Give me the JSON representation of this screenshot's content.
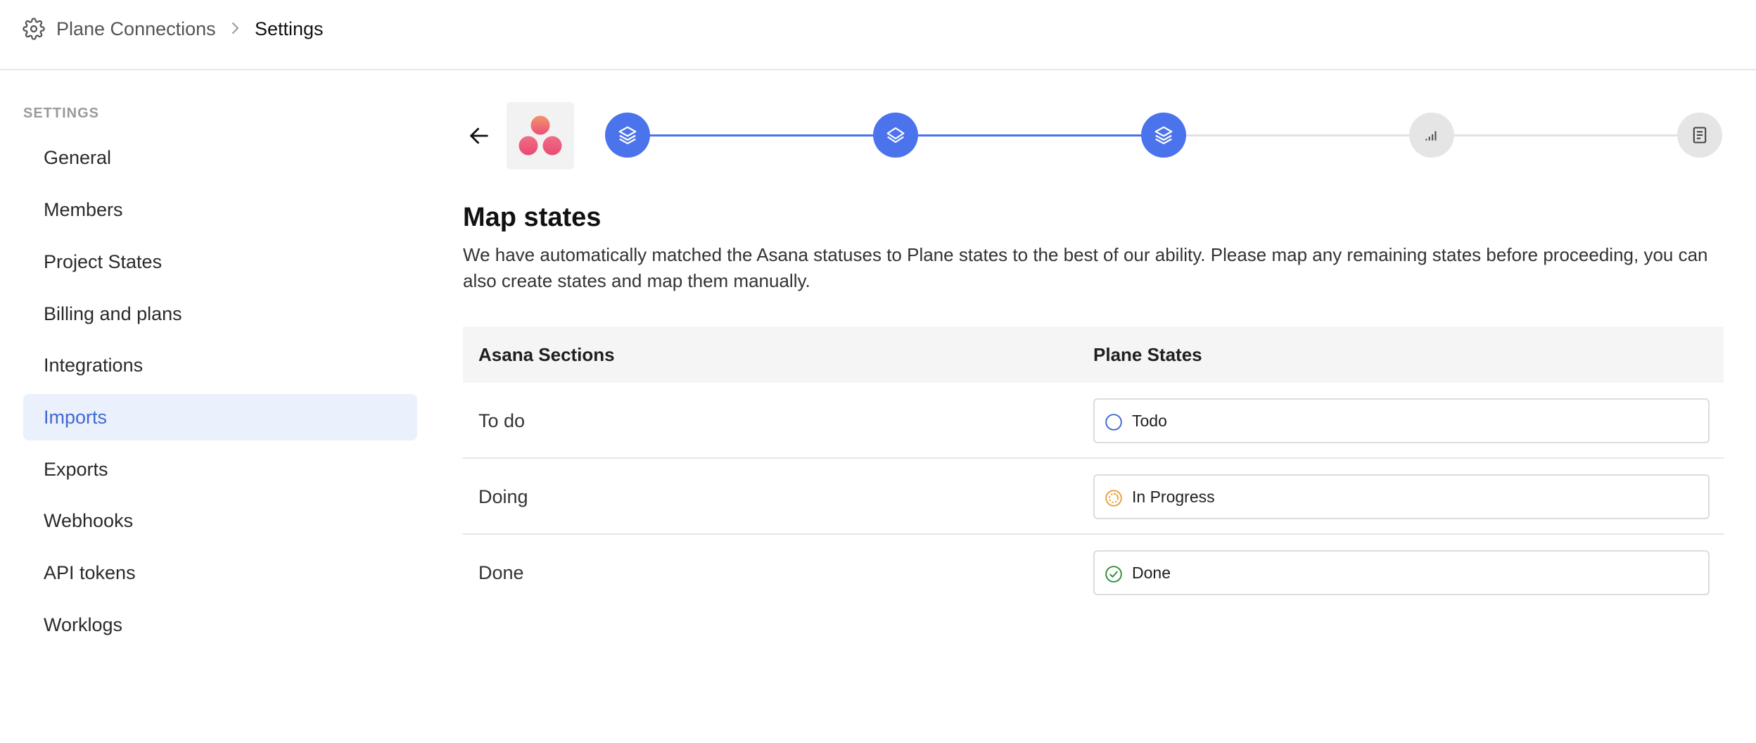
{
  "header": {
    "breadcrumb_root": "Plane Connections",
    "breadcrumb_current": "Settings"
  },
  "sidebar": {
    "heading": "SETTINGS",
    "items": [
      {
        "label": "General"
      },
      {
        "label": "Members"
      },
      {
        "label": "Project States"
      },
      {
        "label": "Billing and plans"
      },
      {
        "label": "Integrations"
      },
      {
        "label": "Imports"
      },
      {
        "label": "Exports"
      },
      {
        "label": "Webhooks"
      },
      {
        "label": "API tokens"
      },
      {
        "label": "Worklogs"
      }
    ],
    "active_item": "Imports"
  },
  "stepper": {
    "steps": [
      {
        "icon": "layers-icon",
        "status": "done"
      },
      {
        "icon": "layers-icon",
        "status": "done"
      },
      {
        "icon": "layers-icon",
        "status": "current"
      },
      {
        "icon": "signal-bars-icon",
        "status": "pending"
      },
      {
        "icon": "document-icon",
        "status": "pending"
      }
    ],
    "colors": {
      "done": "#4a73ec",
      "pending": "#e5e5e5"
    }
  },
  "main": {
    "title": "Map states",
    "description": "We have automatically matched the Asana statuses to Plane states to the best of our ability. Please map any remaining states before proceeding, you can also create states and map them manually.",
    "table": {
      "headers": [
        "Asana Sections",
        "Plane States"
      ],
      "rows": [
        {
          "section": "To do",
          "state": "Todo",
          "state_icon": "todo-circle-icon",
          "state_color": "#3f69d1"
        },
        {
          "section": "Doing",
          "state": "In Progress",
          "state_icon": "in-progress-icon",
          "state_color": "#e8a23b"
        },
        {
          "section": "Done",
          "state": "Done",
          "state_icon": "done-check-icon",
          "state_color": "#2f8f3a"
        }
      ]
    }
  }
}
